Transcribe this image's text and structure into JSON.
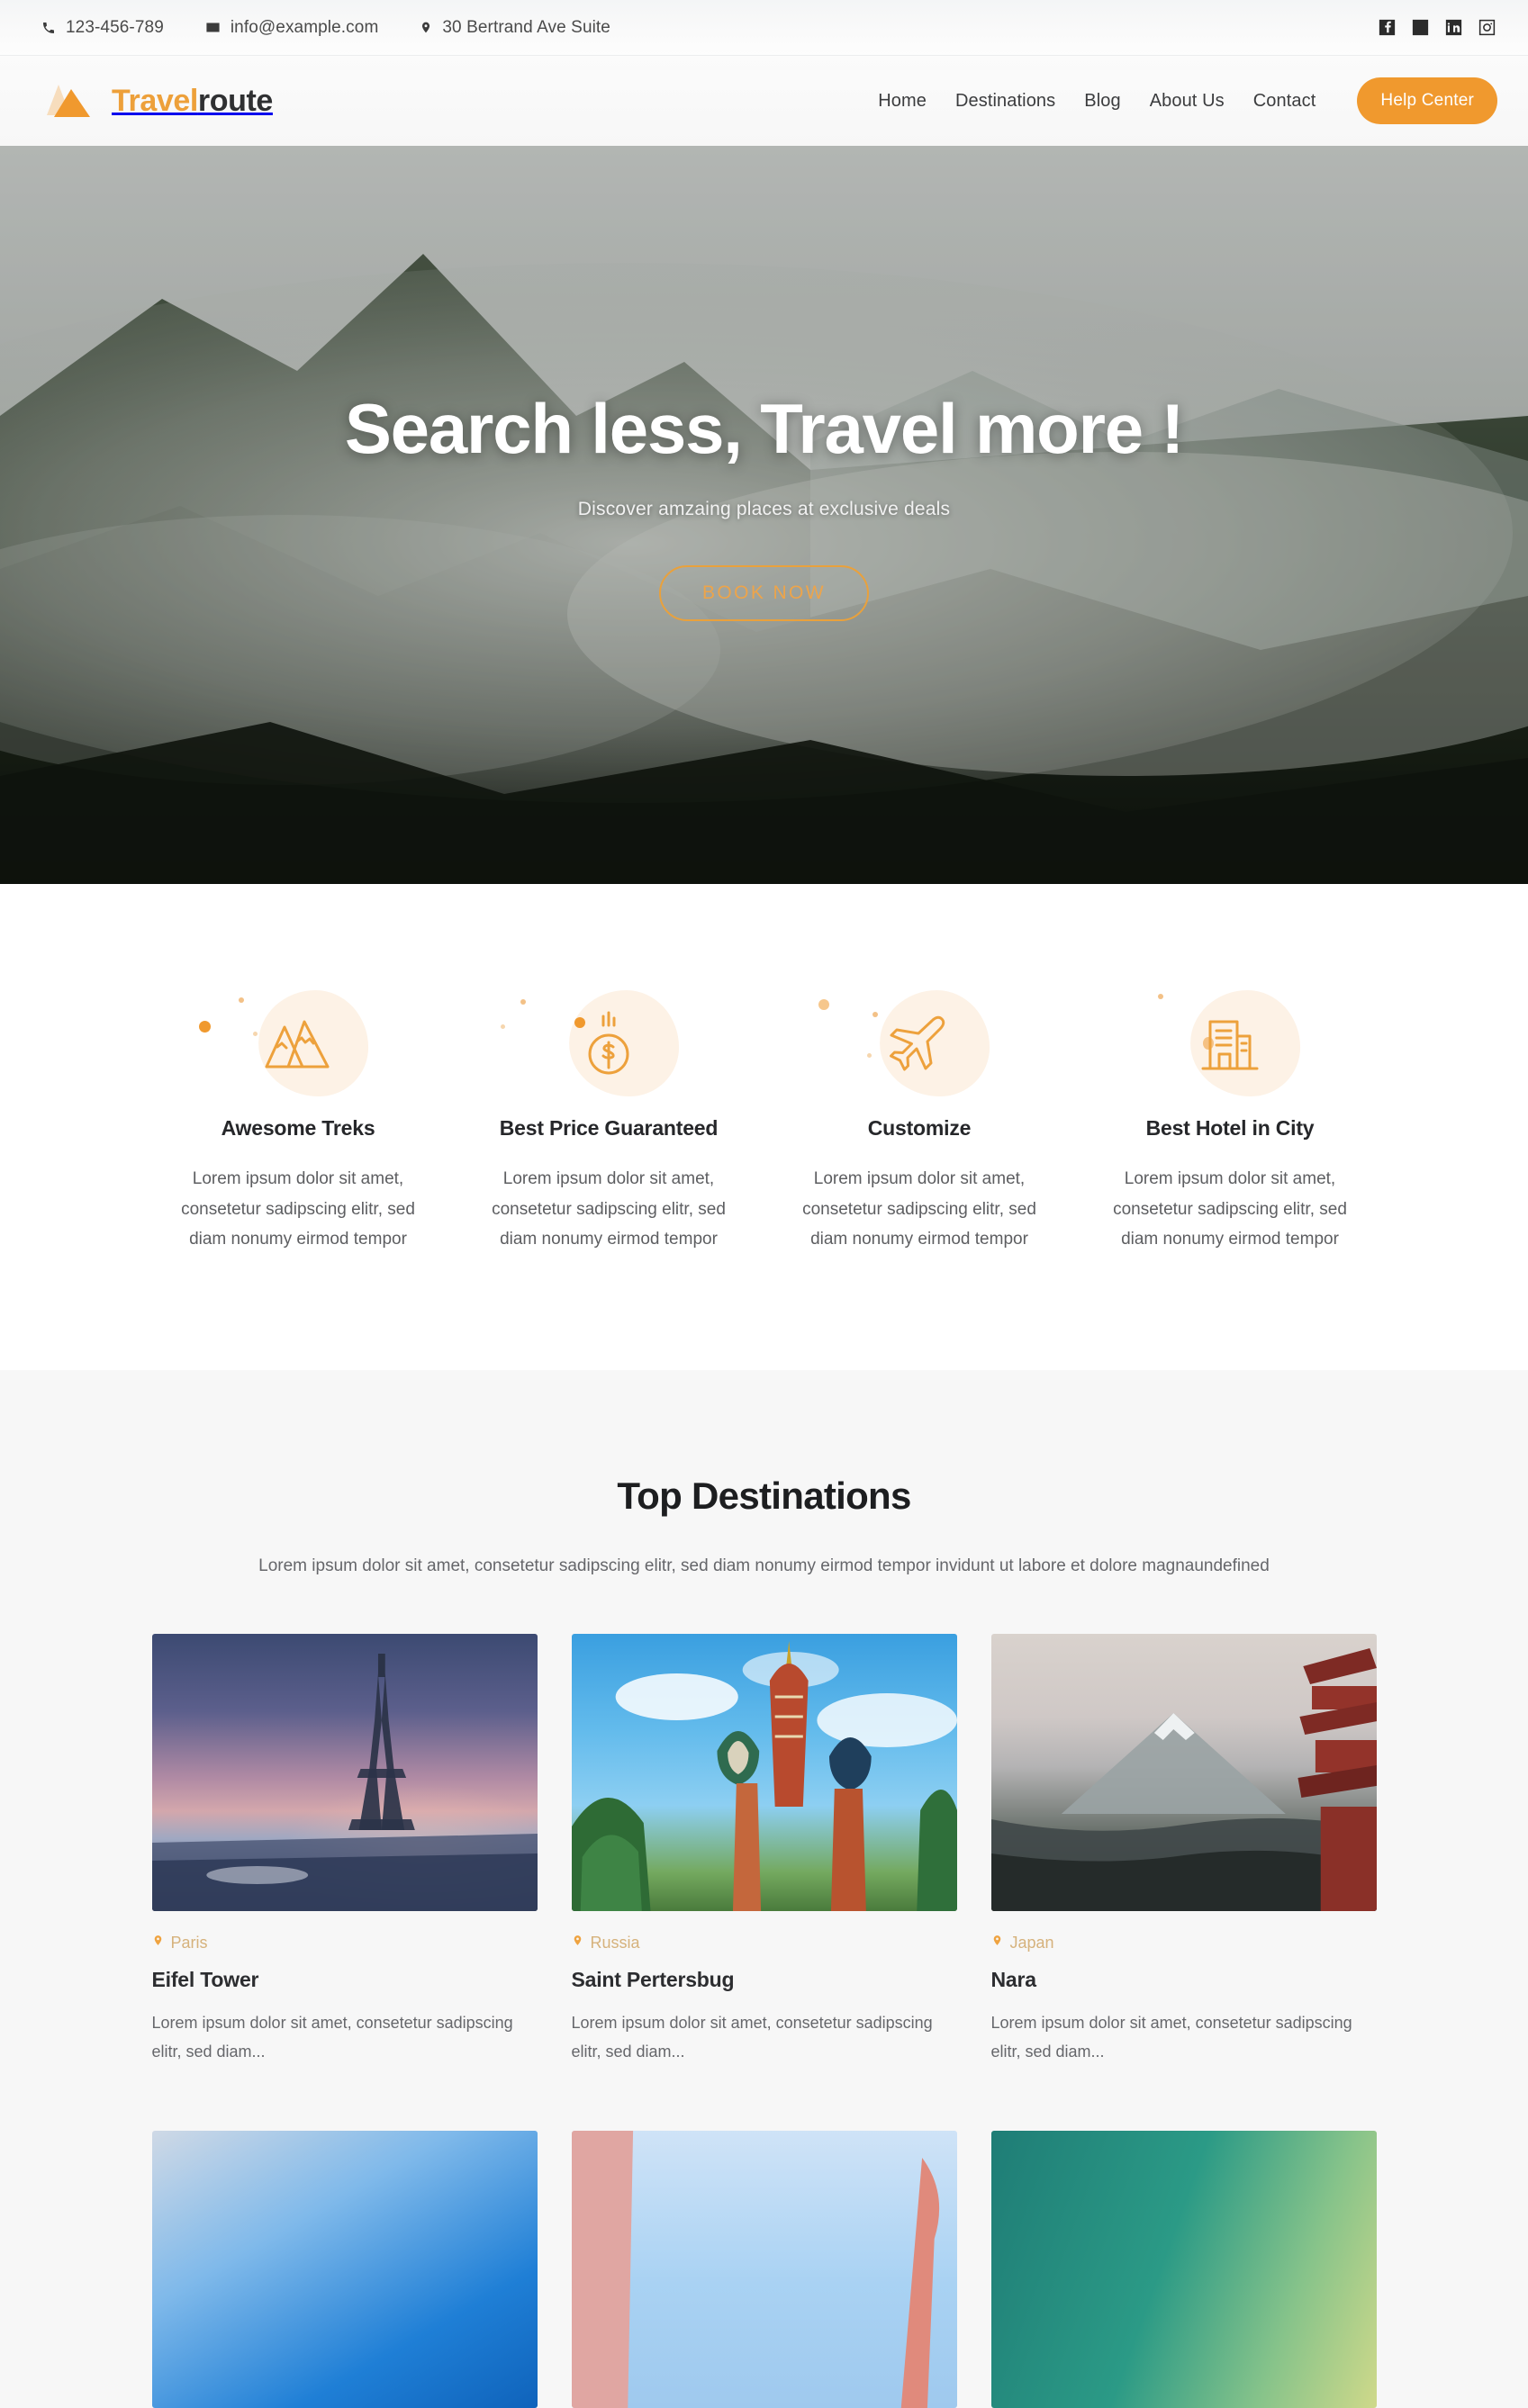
{
  "topbar": {
    "phone": "123-456-789",
    "email": "info@example.com",
    "address": "30 Bertrand Ave Suite",
    "phone_icon": "phone-icon",
    "email_icon": "envelope-icon",
    "address_icon": "map-pin-icon",
    "social": [
      {
        "name": "facebook-icon",
        "label": "Facebook"
      },
      {
        "name": "twitter-icon",
        "label": "Twitter"
      },
      {
        "name": "linkedin-icon",
        "label": "LinkedIn"
      },
      {
        "name": "instagram-icon",
        "label": "Instagram"
      }
    ]
  },
  "header": {
    "logo_primary": "Travel",
    "logo_secondary": "route",
    "nav": [
      {
        "label": "Home"
      },
      {
        "label": "Destinations"
      },
      {
        "label": "Blog"
      },
      {
        "label": "About Us"
      },
      {
        "label": "Contact"
      }
    ],
    "cta_label": "Help Center"
  },
  "hero": {
    "title": "Search less, Travel more !",
    "subtitle": "Discover amzaing places at exclusive deals",
    "button_label": "BOOK NOW"
  },
  "features": [
    {
      "icon": "mountain-icon",
      "title": "Awesome Treks",
      "desc": "Lorem ipsum dolor sit amet, consetetur sadipscing elitr, sed diam nonumy eirmod tempor"
    },
    {
      "icon": "dollar-coin-icon",
      "title": "Best Price Guaranteed",
      "desc": "Lorem ipsum dolor sit amet, consetetur sadipscing elitr, sed diam nonumy eirmod tempor"
    },
    {
      "icon": "airplane-icon",
      "title": "Customize",
      "desc": "Lorem ipsum dolor sit amet, consetetur sadipscing elitr, sed diam nonumy eirmod tempor"
    },
    {
      "icon": "buildings-icon",
      "title": "Best Hotel in City",
      "desc": "Lorem ipsum dolor sit amet, consetetur sadipscing elitr, sed diam nonumy eirmod tempor"
    }
  ],
  "destinations": {
    "title": "Top Destinations",
    "subtitle": "Lorem ipsum dolor sit amet, consetetur sadipscing elitr, sed diam nonumy eirmod tempor invidunt ut labore et dolore magnaundefined",
    "cards": [
      {
        "location": "Paris",
        "title": "Eifel Tower",
        "desc": "Lorem ipsum dolor sit amet, consetetur sadipscing elitr, sed diam...",
        "image": "eiffel-tower-photo"
      },
      {
        "location": "Russia",
        "title": "Saint Pertersbug",
        "desc": "Lorem ipsum dolor sit amet, consetetur sadipscing elitr, sed diam...",
        "image": "saint-basil-cathedral-photo"
      },
      {
        "location": "Japan",
        "title": "Nara",
        "desc": "Lorem ipsum dolor sit amet, consetetur sadipscing elitr, sed diam...",
        "image": "mount-fuji-pagoda-photo"
      }
    ],
    "cards_row2": [
      {
        "image": "blue-sky-photo"
      },
      {
        "image": "pink-building-photo"
      },
      {
        "image": "teal-water-photo"
      }
    ]
  },
  "colors": {
    "accent": "#f0992e",
    "accent_light": "#fdf2e6",
    "text_dark": "#26272a",
    "text_muted": "#65666a",
    "section_bg": "#f7f7f7"
  }
}
